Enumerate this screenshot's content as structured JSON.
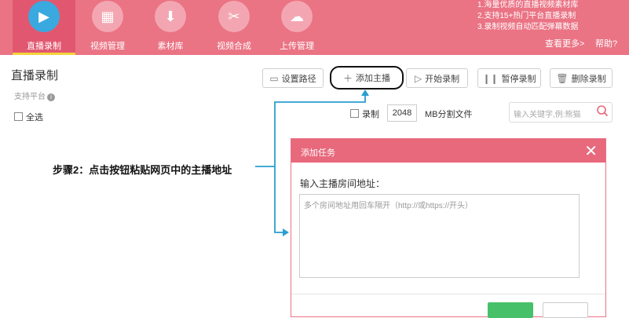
{
  "nav": [
    {
      "label": "直播录制",
      "icon": "video-play-icon",
      "glyph": "▶",
      "active": true
    },
    {
      "label": "视频管理",
      "icon": "film-icon",
      "glyph": "▦",
      "active": false
    },
    {
      "label": "素材库",
      "icon": "download-box-icon",
      "glyph": "⬇",
      "active": false
    },
    {
      "label": "视频合成",
      "icon": "scissors-icon",
      "glyph": "✂",
      "active": false
    },
    {
      "label": "上传管理",
      "icon": "cloud-upload-icon",
      "glyph": "☁",
      "active": false
    }
  ],
  "promo": {
    "line1": "1.海量优质的直播视频素材库",
    "line2": "2.支持15+热门平台直播录制",
    "line3": "3.录制视频自动匹配弹幕数据",
    "more": "查看更多>",
    "help": "帮助?"
  },
  "page": {
    "title": "直播录制",
    "platform": "支持平台",
    "select_all": "全选"
  },
  "toolbar": {
    "set_path": "设置路径",
    "add_streamer": "添加主播",
    "start_record": "开始录制",
    "pause_record": "暂停录制",
    "delete_record": "删除录制"
  },
  "options": {
    "record_label": "录制",
    "split_size": "2048",
    "split_label": "MB分割文件",
    "search_placeholder": "输入关键字,例:熊猫"
  },
  "annotation": "步骤2：点击按钮粘贴网页中的主播地址",
  "dialog": {
    "title": "添加任务",
    "label": "输入主播房间地址：",
    "placeholder": "多个房间地址用回车隔开（http://或https://开头）"
  },
  "colors": {
    "header": "#ea7384",
    "dialog_header": "#e8687c",
    "accent_blue": "#2a9fd0"
  }
}
